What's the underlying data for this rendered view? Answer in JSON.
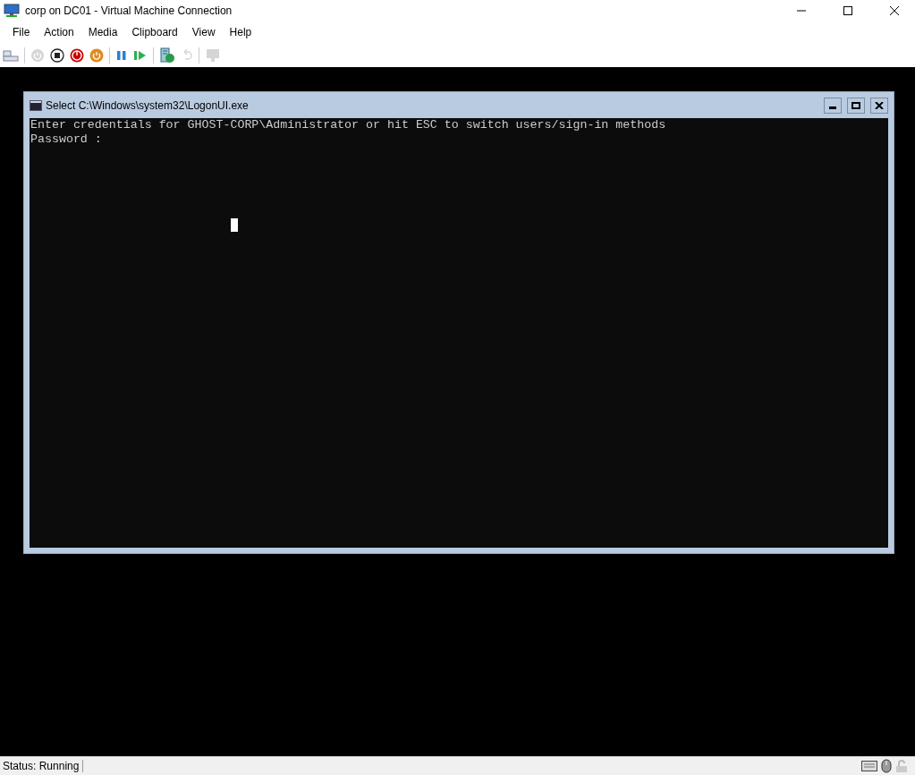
{
  "window": {
    "title": "corp on DC01 - Virtual Machine Connection"
  },
  "menu": [
    "File",
    "Action",
    "Media",
    "Clipboard",
    "View",
    "Help"
  ],
  "toolbar": [
    {
      "kind": "ctrl-alt-del",
      "disabled": false
    },
    {
      "kind": "sep"
    },
    {
      "kind": "start",
      "disabled": true
    },
    {
      "kind": "turn-off",
      "disabled": false
    },
    {
      "kind": "shut-down",
      "disabled": false
    },
    {
      "kind": "save",
      "disabled": false
    },
    {
      "kind": "sep"
    },
    {
      "kind": "pause",
      "disabled": false
    },
    {
      "kind": "reset",
      "disabled": false
    },
    {
      "kind": "sep"
    },
    {
      "kind": "checkpoint",
      "disabled": false
    },
    {
      "kind": "revert",
      "disabled": true
    },
    {
      "kind": "sep"
    },
    {
      "kind": "enhanced-session",
      "disabled": true
    }
  ],
  "console": {
    "title": "Select C:\\Windows\\system32\\LogonUI.exe",
    "lines": [
      "Enter credentials for GHOST-CORP\\Administrator or hit ESC to switch users/sign-in methods",
      "Password :"
    ]
  },
  "status_bar": {
    "text": "Status: Running"
  }
}
